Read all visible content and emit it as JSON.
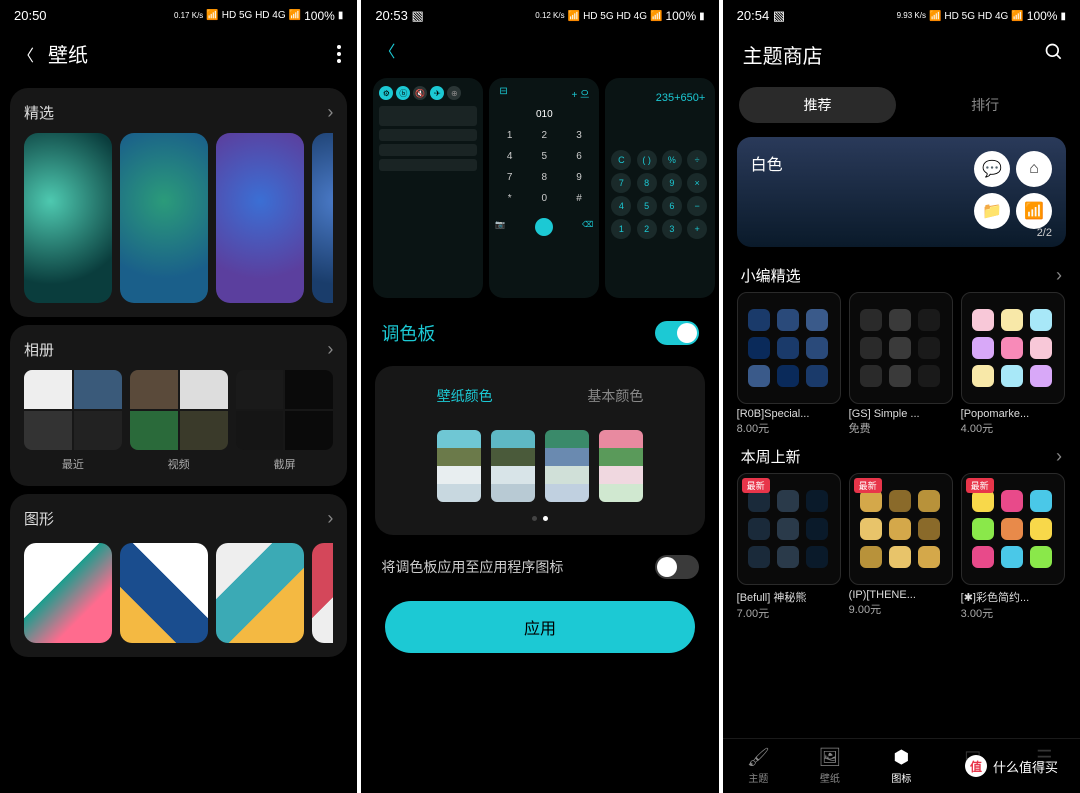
{
  "phone1": {
    "time": "20:50",
    "speed": "0.17\nK/s",
    "signals": "HD 5G HD 4G",
    "battery": "100%",
    "title": "壁纸",
    "sections": {
      "featured": "精选",
      "album": "相册",
      "shapes": "图形"
    },
    "albums": [
      "最近",
      "视频",
      "截屏"
    ]
  },
  "phone2": {
    "time": "20:53",
    "speed": "0.12\nK/s",
    "signals": "HD 5G HD 4G",
    "battery": "100%",
    "calc_expr": "235+650+",
    "dial_display": "010",
    "keypad": [
      "1",
      "2",
      "3",
      "4",
      "5",
      "6",
      "7",
      "8",
      "9",
      "*",
      "0",
      "#"
    ],
    "palette_label": "调色板",
    "tabs": [
      "壁纸颜色",
      "基本颜色"
    ],
    "swatches": [
      [
        "#6fc7d4",
        "#6b7a4a",
        "#e8eef0",
        "#c8d8e0"
      ],
      [
        "#5eb8c4",
        "#4a5a3a",
        "#d8e4e8",
        "#b8cad4"
      ],
      [
        "#3a8a6a",
        "#6a8ab0",
        "#d0e0d8",
        "#c0d0e0"
      ],
      [
        "#e88aa0",
        "#5a9a5a",
        "#f0d8e0",
        "#d0e8d0"
      ]
    ],
    "apply_icons": "将调色板应用至应用程序图标",
    "apply_btn": "应用"
  },
  "phone3": {
    "time": "20:54",
    "speed": "9.93\nK/s",
    "signals": "HD 5G HD 4G",
    "battery": "100%",
    "title": "主题商店",
    "tabs": [
      "推荐",
      "排行"
    ],
    "banner_label": "白色",
    "banner_page": "2/2",
    "sec1": "小编精选",
    "sec2": "本周上新",
    "themes1": [
      {
        "name": "[R0B]Special...",
        "price": "8.00元"
      },
      {
        "name": "[GS] Simple ...",
        "price": "免费"
      },
      {
        "name": "[Popomarke...",
        "price": "4.00元"
      }
    ],
    "themes2": [
      {
        "name": "[Befull] 神秘熊",
        "price": "7.00元",
        "badge": "最新"
      },
      {
        "name": "(IP)[THENE...",
        "price": "9.00元",
        "badge": "最新"
      },
      {
        "name": "[✱]彩色简约...",
        "price": "3.00元",
        "badge": "最新"
      }
    ],
    "nav": [
      "主题",
      "壁纸",
      "图标",
      "",
      ""
    ]
  },
  "watermark": "什么值得买"
}
